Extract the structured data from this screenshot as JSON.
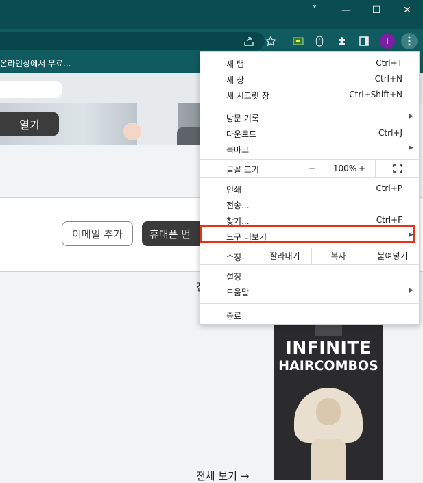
{
  "window": {
    "controls": [
      "˅",
      "—",
      "☐",
      "✕"
    ]
  },
  "toolbar": {
    "profile_initial": "I",
    "icons": [
      "share-icon",
      "star-icon",
      "extension-green-icon",
      "extension-mouse-icon",
      "puzzle-icon",
      "side-panel-icon",
      "avatar",
      "menu-dots-icon"
    ]
  },
  "bookmark_bar": {
    "text": "온라인상에서 무료..."
  },
  "page": {
    "open_button": "열기",
    "email_button": "이메일 추가",
    "phone_button": "휴대폰 번",
    "see_all_partial": "전",
    "see_all": "전체 보기 →",
    "ad_title_1": "INFINITE",
    "ad_title_2": "HAIRCOMBOS"
  },
  "menu": {
    "items_top": [
      {
        "label": "새 탭",
        "shortcut": "Ctrl+T"
      },
      {
        "label": "새 창",
        "shortcut": "Ctrl+N"
      },
      {
        "label": "새 시크릿 창",
        "shortcut": "Ctrl+Shift+N"
      }
    ],
    "items_history": [
      {
        "label": "방문 기록",
        "shortcut": "",
        "submenu": true
      },
      {
        "label": "다운로드",
        "shortcut": "Ctrl+J",
        "submenu": false
      },
      {
        "label": "북마크",
        "shortcut": "",
        "submenu": true
      }
    ],
    "zoom": {
      "label": "글꼴 크기",
      "minus": "−",
      "value": "100%",
      "plus": "+",
      "fullscreen": "⛶"
    },
    "items_tools": [
      {
        "label": "인쇄",
        "shortcut": "Ctrl+P"
      },
      {
        "label": "전송...",
        "shortcut": ""
      },
      {
        "label": "찾기...",
        "shortcut": "Ctrl+F"
      },
      {
        "label": "도구 더보기",
        "shortcut": "",
        "submenu": true
      }
    ],
    "edit": {
      "label": "수정",
      "cut": "잘라내기",
      "copy": "복사",
      "paste": "붙여넣기"
    },
    "items_settings": [
      {
        "label": "설정",
        "submenu": false
      },
      {
        "label": "도움말",
        "submenu": true
      }
    ],
    "exit": "종료"
  },
  "colors": {
    "titlebar": "#0b4c51",
    "toolbar": "#0f5b5f",
    "highlight": "#e8321c",
    "avatar": "#7b1fa2"
  }
}
